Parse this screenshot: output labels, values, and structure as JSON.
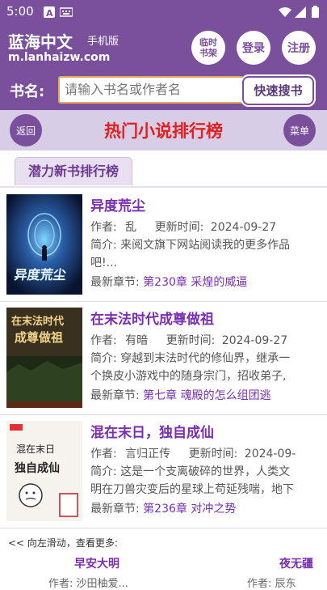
{
  "status": {
    "time": "5:00"
  },
  "header": {
    "site_name": "蓝海中文",
    "site_sub": "手机版",
    "site_url": "m.lanhaizw.com",
    "btn_shelf_line1": "临时",
    "btn_shelf_line2": "书架",
    "btn_login": "登录",
    "btn_register": "注册"
  },
  "search": {
    "label": "书名:",
    "placeholder": "请输入书名或作者名",
    "button": "快速搜书"
  },
  "titlebar": {
    "back": "返回",
    "title": "热门小说排行榜",
    "menu": "菜单"
  },
  "tab": {
    "label": "潜力新书排行榜"
  },
  "books": [
    {
      "title": "异度荒尘",
      "author_label": "作者:",
      "author": "乱",
      "updated_label": "更新时间:",
      "updated": "2024-09-27",
      "intro_label": "简介:",
      "intro_1": "来阅文旗下网站阅读我的更多作品",
      "intro_2": "吧!...",
      "latest_label": "最新章节:",
      "latest": "第230章 采煌的威逼",
      "cover_text": "异度荒尘"
    },
    {
      "title": "在末法时代成尊做祖",
      "author_label": "作者:",
      "author": "有暗",
      "updated_label": "更新时间:",
      "updated": "2024-09-27",
      "intro_label": "简介:",
      "intro_1": "穿越到末法时代的修仙界，继承一",
      "intro_2": "个换皮小游戏中的随身宗门，招收弟子,",
      "latest_label": "最新章节:",
      "latest": "第七章 魂殿的怎么组团逃",
      "cover_text_1": "在末法时代",
      "cover_text_2": "成尊做祖"
    },
    {
      "title": "混在末日，独自成仙",
      "author_label": "作者:",
      "author": "言归正传",
      "updated_label": "更新时间:",
      "updated": "2024-09-",
      "intro_label": "简介:",
      "intro_1": "这是一个支离破碎的世界，人类文",
      "intro_2": "明在刀兽灾变后的星球上苟延残喘，地下",
      "latest_label": "最新章节:",
      "latest": "第236章 对冲之势",
      "cover_text_1": "混在末日",
      "cover_text_2": "独自成仙"
    }
  ],
  "more": {
    "hint": "<< 向左滑动，查看更多:",
    "book1": "早安大明",
    "book2": "夜无疆",
    "author1": "作者: 沙田柚爱...",
    "author2": "作者: 辰东"
  }
}
